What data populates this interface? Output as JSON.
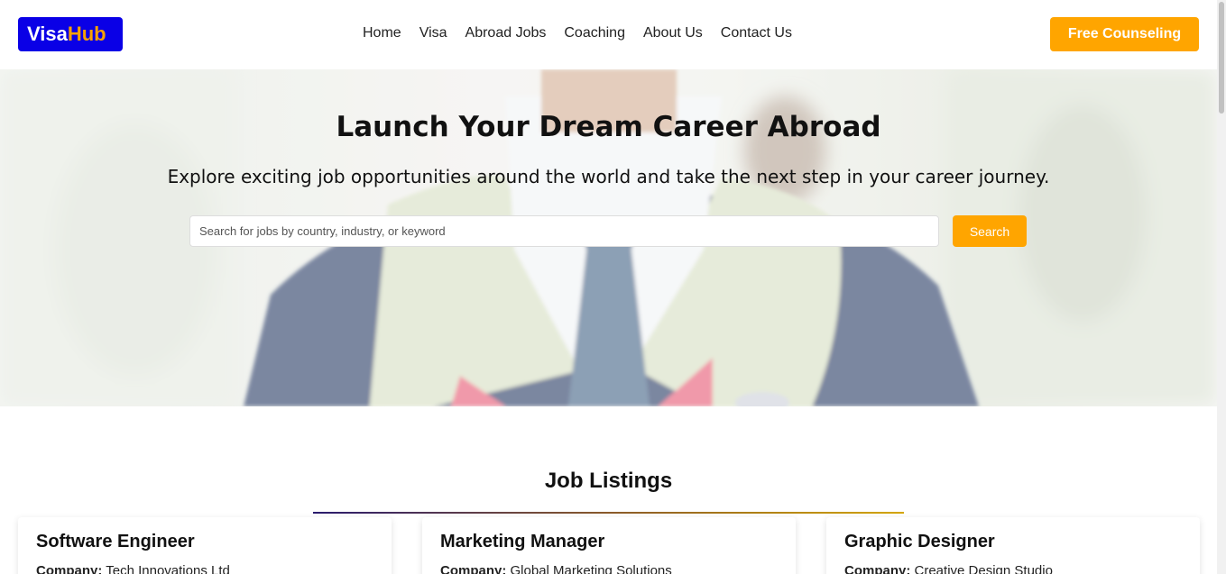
{
  "header": {
    "logo_part1": "Visa",
    "logo_part2": "Hub",
    "nav": [
      "Home",
      "Visa",
      "Abroad Jobs",
      "Coaching",
      "About Us",
      "Contact Us"
    ],
    "cta_label": "Free Counseling"
  },
  "hero": {
    "title": "Launch Your Dream Career Abroad",
    "subtitle": "Explore exciting job opportunities around the world and take the next step in your career journey.",
    "search_placeholder": "Search for jobs by country, industry, or keyword",
    "search_button": "Search"
  },
  "listings": {
    "title": "Job Listings",
    "company_label": "Company:",
    "jobs": [
      {
        "title": "Software Engineer",
        "company": "Tech Innovations Ltd"
      },
      {
        "title": "Marketing Manager",
        "company": "Global Marketing Solutions"
      },
      {
        "title": "Graphic Designer",
        "company": "Creative Design Studio"
      }
    ]
  },
  "colors": {
    "brand": "#0a00e6",
    "accent": "#ffa500"
  }
}
